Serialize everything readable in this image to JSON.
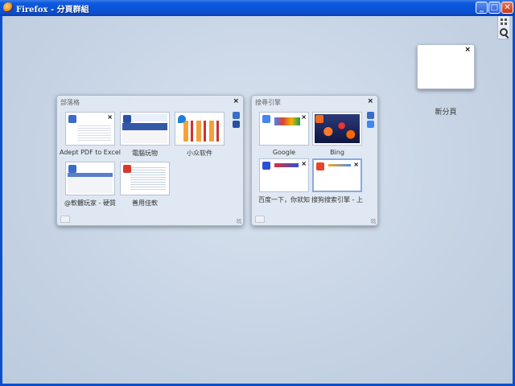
{
  "window": {
    "title": "Firefox - 分頁群組",
    "minimize": "_",
    "maximize": "□",
    "close": "✕"
  },
  "colors": {
    "titlebar": "#0a4fcf",
    "workspace": "#c9d6e6",
    "active_tab_border": "#8aa8e0"
  },
  "groups": [
    {
      "title": "部落格",
      "close": "×",
      "tabs": [
        {
          "label": "Adept PDF to Excel",
          "favicon": "#3a6cc8",
          "close": "×"
        },
        {
          "label": "電腦玩物",
          "favicon": "#2a4fa0",
          "close": "×"
        },
        {
          "label": "小众软件",
          "favicon": "#1e7fd8",
          "close": "×"
        },
        {
          "label": "@軟體玩家 - 硬質",
          "favicon": "#3a6cc8",
          "close": "×"
        },
        {
          "label": "善用佳軟",
          "favicon": "#d83a2a",
          "close": "×"
        }
      ]
    },
    {
      "title": "搜尋引擎",
      "close": "×",
      "tabs": [
        {
          "label": "Google",
          "favicon": "#4285f4",
          "close": "×"
        },
        {
          "label": "Bing",
          "favicon": "#f26a1b",
          "close": "×"
        },
        {
          "label": "百度一下，你就知",
          "favicon": "#2b4fd6",
          "close": "×"
        },
        {
          "label": "搜狗搜索引擎 - 上",
          "favicon": "#e8442a",
          "close": "×"
        }
      ]
    }
  ],
  "new_tab": {
    "label": "新分頁",
    "close": "×"
  }
}
